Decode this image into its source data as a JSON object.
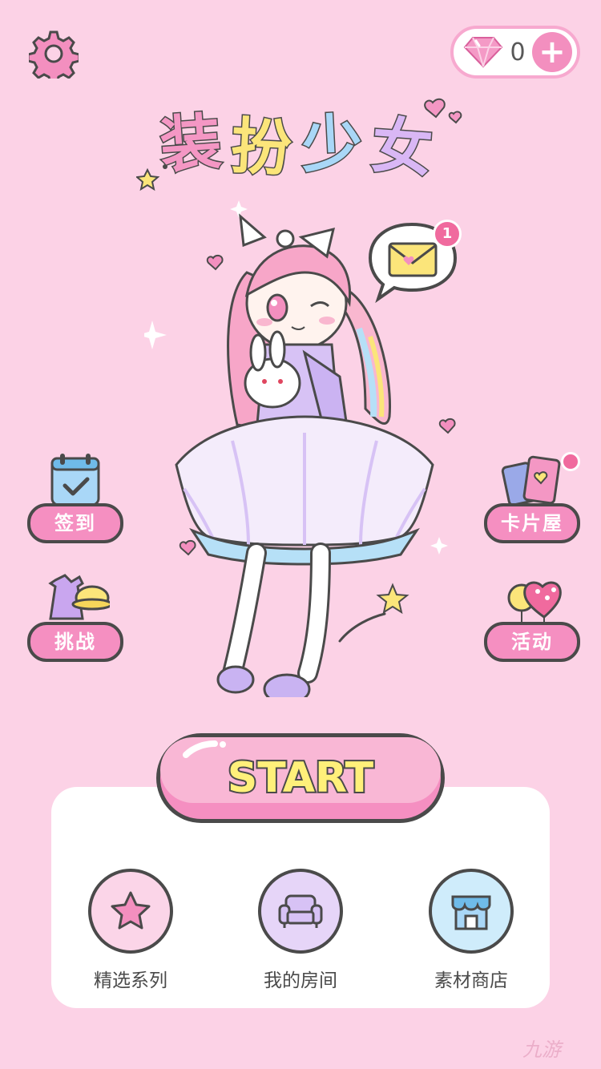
{
  "game_title": "装扮少女",
  "currency": {
    "icon": "diamond-icon",
    "count": "0",
    "add_symbol": "+"
  },
  "mail": {
    "badge_count": "1"
  },
  "left_buttons": [
    {
      "label": "签到",
      "icon": "calendar-check-icon"
    },
    {
      "label": "挑战",
      "icon": "clothes-hat-icon"
    }
  ],
  "right_buttons": [
    {
      "label": "卡片屋",
      "icon": "cards-icon",
      "has_dot": true
    },
    {
      "label": "活动",
      "icon": "balloons-icon"
    }
  ],
  "start_button": {
    "label": "START"
  },
  "menu": [
    {
      "label": "精选系列",
      "icon": "star-icon",
      "bg": "#fbd5e8"
    },
    {
      "label": "我的房间",
      "icon": "sofa-icon",
      "bg": "#e6d5f8"
    },
    {
      "label": "素材商店",
      "icon": "shop-icon",
      "bg": "#cfecfb"
    }
  ],
  "watermark": "九游",
  "colors": {
    "background": "#fcd2e6",
    "accent_pink": "#f58fc1",
    "start_text": "#fff07a",
    "outline": "#4a4a4a"
  }
}
